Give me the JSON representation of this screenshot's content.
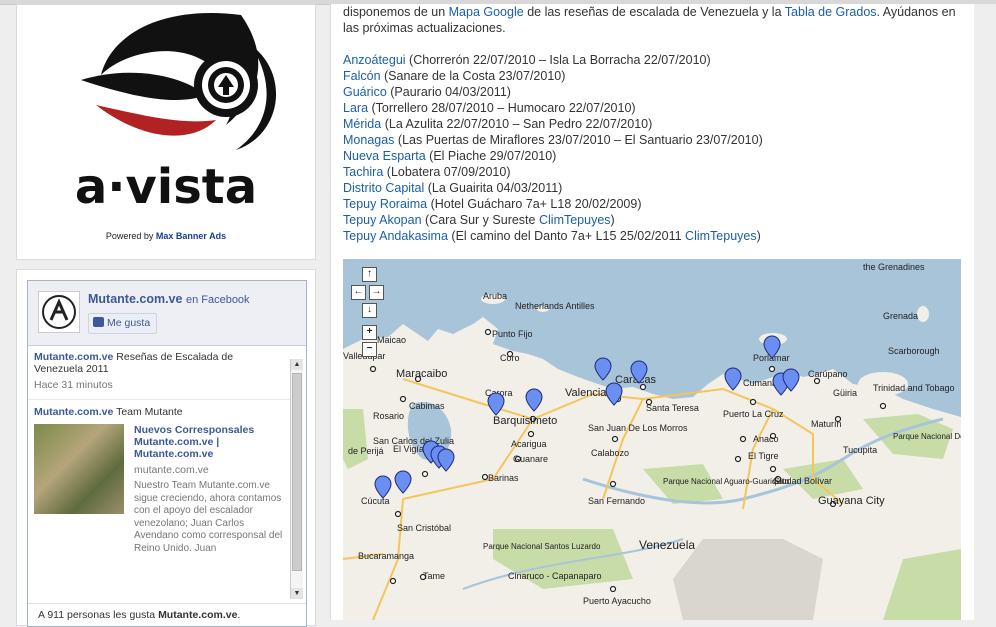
{
  "sidebar": {
    "ad": {
      "logo_text": "a·vista",
      "powered_prefix": "Powered by",
      "powered_link": "Max Banner Ads"
    },
    "facebook": {
      "page_name": "Mutante.com.ve",
      "on_facebook": "en Facebook",
      "like_button": "Me gusta",
      "posts": [
        {
          "author": "Mutante.com.ve",
          "text": "Reseñas de Escalada de Venezuela 2011",
          "time": "Hace 31 minutos"
        },
        {
          "author": "Mutante.com.ve",
          "text": "Team Mutante",
          "card_title": "Nuevos Corresponsales Mutante.com.ve | Mutante.com.ve",
          "card_domain": "mutante.com.ve",
          "card_desc": "Nuestro Team Mutante.com.ve sigue creciendo, ahora contamos con el apoyo del escalador venezolano; Juan Carlos Avendano como corresponsal del Reino Unido. Juan"
        }
      ],
      "footer_prefix": "A 911 personas les gusta",
      "footer_page": "Mutante.com.ve",
      "footer_suffix": "."
    }
  },
  "main": {
    "intro": {
      "part1": "disponemos de un",
      "link1": "Mapa Google",
      "part2": "de las reseñas de escalada de Venezuela y la",
      "link2": "Tabla de Grados",
      "part3": ". Ayúdanos en las próximas actualizaciones."
    },
    "regions": [
      {
        "name": "Anzoátegui",
        "detail": "(Chorrerón 22/07/2010 – Isla La Borracha 22/07/2010)"
      },
      {
        "name": "Falcón",
        "detail": "(Sanare de la Costa 23/07/2010)"
      },
      {
        "name": "Guárico",
        "detail": "(Paurario 04/03/2011)"
      },
      {
        "name": "Lara",
        "detail": "(Torrellero 28/07/2010 – Humocaro 22/07/2010)"
      },
      {
        "name": "Mérida",
        "detail": "(La Azulita 22/07/2010 – San Pedro 22/07/2010)"
      },
      {
        "name": "Monagas",
        "detail": "(Las Puertas de Miraflores 23/07/2010 – El Santuario 23/07/2010)"
      },
      {
        "name": "Nueva Esparta",
        "detail": "(El Piache 29/07/2010)"
      },
      {
        "name": "Tachira",
        "detail": "(Lobatera 07/09/2010)"
      },
      {
        "name": "Distrito Capital",
        "detail": "(La Guairita 04/03/2011)"
      },
      {
        "name": "Tepuy Roraima",
        "detail": "(Hotel Guácharo 7a+ L18 20/02/2009)"
      },
      {
        "name": "Tepuy Akopan",
        "detail": "(Cara Sur y Sureste",
        "link": "ClimTepuyes",
        "tail": ")"
      },
      {
        "name": "Tepuy Andakasima",
        "detail": "(El camino del Danto 7a+ L15 25/02/2011",
        "link": "ClimTepuyes",
        "tail": ")"
      }
    ],
    "map": {
      "controls": [
        "↑",
        "←",
        "→",
        "↓",
        "+",
        "−"
      ],
      "labels": {
        "grenadines": "the Grenadines",
        "grenada": "Grenada",
        "aruba": "Aruba",
        "antilles": "Netherlands Antilles",
        "punto_fijo": "Punto Fijo",
        "coro": "Coro",
        "maicao": "Maicao",
        "maracaibo": "Maracaibo",
        "cabimas": "Cabimas",
        "rosario": "Rosario",
        "valledupar": "Valledupar",
        "carora": "Carora",
        "barquisimeto": "Barquisimeto",
        "valencia": "Valencia",
        "caracas": "Caracas",
        "santa_teresa": "Santa Teresa",
        "san_juan": "San Juan De Los Morros",
        "porlamar": "Porlamar",
        "cumana": "Cumaná",
        "carupano": "Carúpano",
        "scarborough": "Scarborough",
        "trinidad": "Trinidad and Tobago",
        "guiria": "Güiria",
        "puerto_la_cruz": "Puerto La Cruz",
        "maturin": "Maturín",
        "anaco": "Anaco",
        "el_tigre": "El Tigre",
        "calabozo": "Calabozo",
        "guanare": "Guanare",
        "acarigua": "Acarigua",
        "barinas": "Barinas",
        "san_carlos": "San Carlos del Zulia",
        "el_vigia": "El Vigía",
        "cucuta": "Cúcuta",
        "san_cristobal": "San Cristóbal",
        "perija": "de Perijá",
        "san_fernando": "San Fernando",
        "aguaro": "Parque Nacional Aguaro-Guariquito",
        "ciudad_bolivar": "Ciudad Bolívar",
        "guayana": "Guayana City",
        "tucupita": "Tucupita",
        "delta": "Parque Nacional Delta del Orino",
        "bucaramanga": "Bucaramanga",
        "tame": "Tame",
        "santos_luzardo": "Parque Nacional Santos Luzardo",
        "cinaruco": "Cinaruco - Capanaparo",
        "venezuela": "Venezuela",
        "puerto_ayacucho": "Puerto Ayacucho"
      }
    }
  }
}
